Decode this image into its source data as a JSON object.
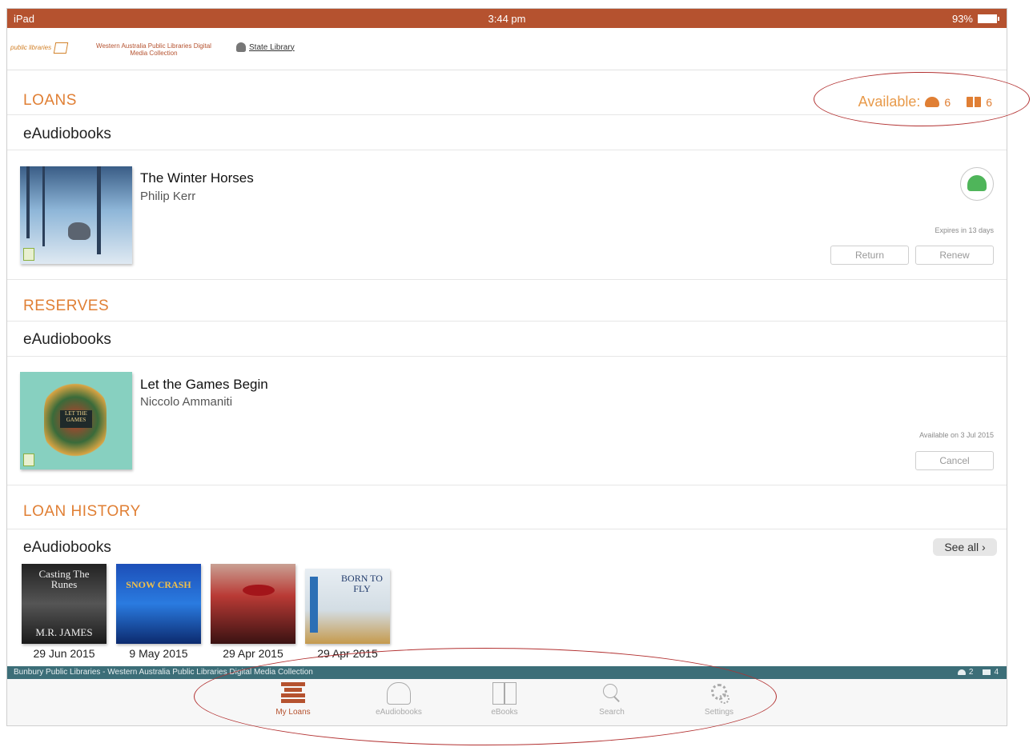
{
  "statusbar": {
    "device": "iPad",
    "time": "3:44 pm",
    "battery": "93%"
  },
  "header": {
    "logo_public": "public libraries",
    "logo_wapl": "Western Australia Public Libraries Digital Media Collection",
    "logo_state": "State Library"
  },
  "loans": {
    "title": "LOANS",
    "available_label": "Available:",
    "available_audio": "6",
    "available_ebooks": "6",
    "category": "eAudiobooks",
    "item": {
      "title": "The Winter Horses",
      "author": "Philip Kerr",
      "expires": "Expires in 13 days",
      "return_label": "Return",
      "renew_label": "Renew"
    }
  },
  "reserves": {
    "title": "RESERVES",
    "category": "eAudiobooks",
    "item": {
      "title": "Let the Games Begin",
      "author": "Niccolo Ammaniti",
      "available_on": "Available on 3 Jul 2015",
      "cancel_label": "Cancel"
    }
  },
  "history": {
    "title": "LOAN HISTORY",
    "category": "eAudiobooks",
    "see_all": "See all",
    "items": [
      {
        "cover_text": "Casting The Runes",
        "cover_author": "M.R. JAMES",
        "date": "29 Jun 2015"
      },
      {
        "cover_text": "SNOW CRASH",
        "cover_author": "",
        "date": "9 May 2015"
      },
      {
        "cover_text": "",
        "cover_author": "",
        "date": "29 Apr 2015"
      },
      {
        "cover_text": "BORN TO FLY",
        "cover_author": "",
        "date": "29 Apr 2015"
      }
    ]
  },
  "footer": {
    "library": "Bunbury Public Libraries - Western Australia Public Libraries Digital Media Collection",
    "audio_count": "2",
    "ebook_count": "4"
  },
  "tabs": [
    {
      "label": "My Loans",
      "icon": "loans-icon"
    },
    {
      "label": "eAudiobooks",
      "icon": "headphones-icon"
    },
    {
      "label": "eBooks",
      "icon": "book-icon"
    },
    {
      "label": "Search",
      "icon": "search-icon"
    },
    {
      "label": "Settings",
      "icon": "gear-icon"
    }
  ],
  "colors": {
    "accent": "#b5522f",
    "section": "#e07f34",
    "footer": "#3c6e78",
    "annotation": "#b23030"
  }
}
